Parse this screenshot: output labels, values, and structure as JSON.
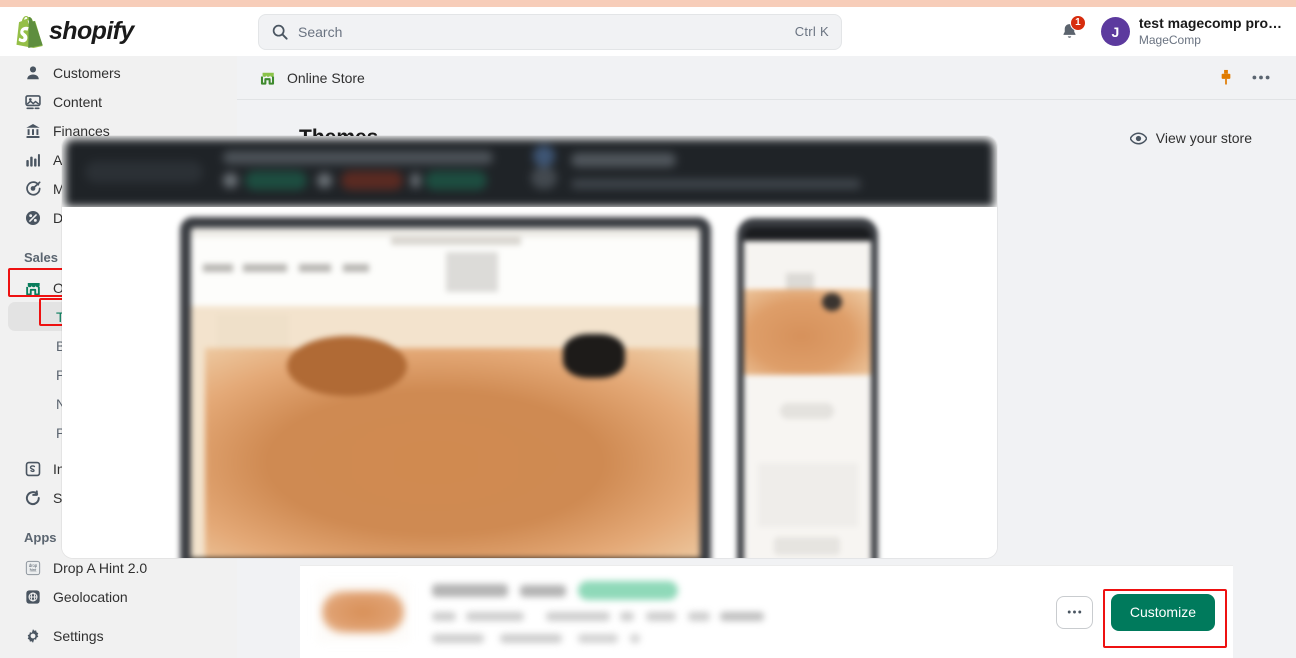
{
  "topbar": {
    "logo_text": "shopify",
    "logo_icon": "shopify-bag-icon",
    "search": {
      "icon": "search-icon",
      "placeholder": "Search",
      "shortcut": "Ctrl K",
      "value": ""
    },
    "notifications": {
      "icon": "bell-icon",
      "badge_count": "1",
      "badge_color": "#d72c0d"
    },
    "account": {
      "avatar_initial": "J",
      "avatar_color": "#5c3a9e",
      "name": "test magecomp pro…",
      "org": "MageComp"
    }
  },
  "sidebar": {
    "items": [
      {
        "label": "Customers",
        "icon": "person-icon"
      },
      {
        "label": "Content",
        "icon": "content-image-icon"
      },
      {
        "label": "Finances",
        "icon": "bank-icon"
      },
      {
        "label": "Analytics",
        "icon": "bar-chart-icon"
      },
      {
        "label": "Marketing",
        "icon": "megaphone-target-icon"
      },
      {
        "label": "Discounts",
        "icon": "discount-tag-icon"
      }
    ],
    "sales_channels": {
      "label": "Sales channels",
      "chevron": "chevron-right-icon",
      "online_store": {
        "label": "Online Store",
        "icon": "storefront-icon"
      },
      "sub_items": [
        {
          "label": "Themes",
          "active": true
        },
        {
          "label": "Blog posts",
          "active": false
        },
        {
          "label": "Pages",
          "active": false
        },
        {
          "label": "Navigation",
          "active": false
        },
        {
          "label": "Preferences",
          "active": false
        }
      ]
    },
    "channel_apps": [
      {
        "label": "Inbox",
        "icon": "inbox-icon"
      },
      {
        "label": "Shop",
        "icon": "shop-bag-icon"
      }
    ],
    "apps": {
      "label": "Apps",
      "chevron": "chevron-right-icon",
      "items": [
        {
          "label": "Drop A Hint 2.0",
          "icon": "drop-a-hint-app-icon"
        },
        {
          "label": "Geolocation",
          "icon": "globe-icon"
        }
      ]
    },
    "settings": {
      "label": "Settings",
      "icon": "gear-icon"
    },
    "active_color": "#0a7d5c"
  },
  "context_header": {
    "icon": "storefront-icon",
    "title": "Online Store",
    "pin_icon": "pushpin-icon",
    "pin_color": "#e07b00",
    "more_icon": "ellipsis-horizontal-icon"
  },
  "page": {
    "title": "Themes",
    "view_store": {
      "label": "View your store",
      "icon": "eye-icon"
    }
  },
  "theme_card": {
    "thumbnail": "theme-thumbnail-blurred",
    "name_redacted": true,
    "badge_redacted": true,
    "badge_color": "#8fd9b9",
    "actions": {
      "more_icon": "ellipsis-horizontal-icon",
      "customize_label": "Customize",
      "customize_color": "#007a5c"
    }
  },
  "annotations": {
    "color": "#ee1111",
    "boxes": [
      "online-store-nav-item",
      "themes-nav-item",
      "customize-button"
    ]
  }
}
